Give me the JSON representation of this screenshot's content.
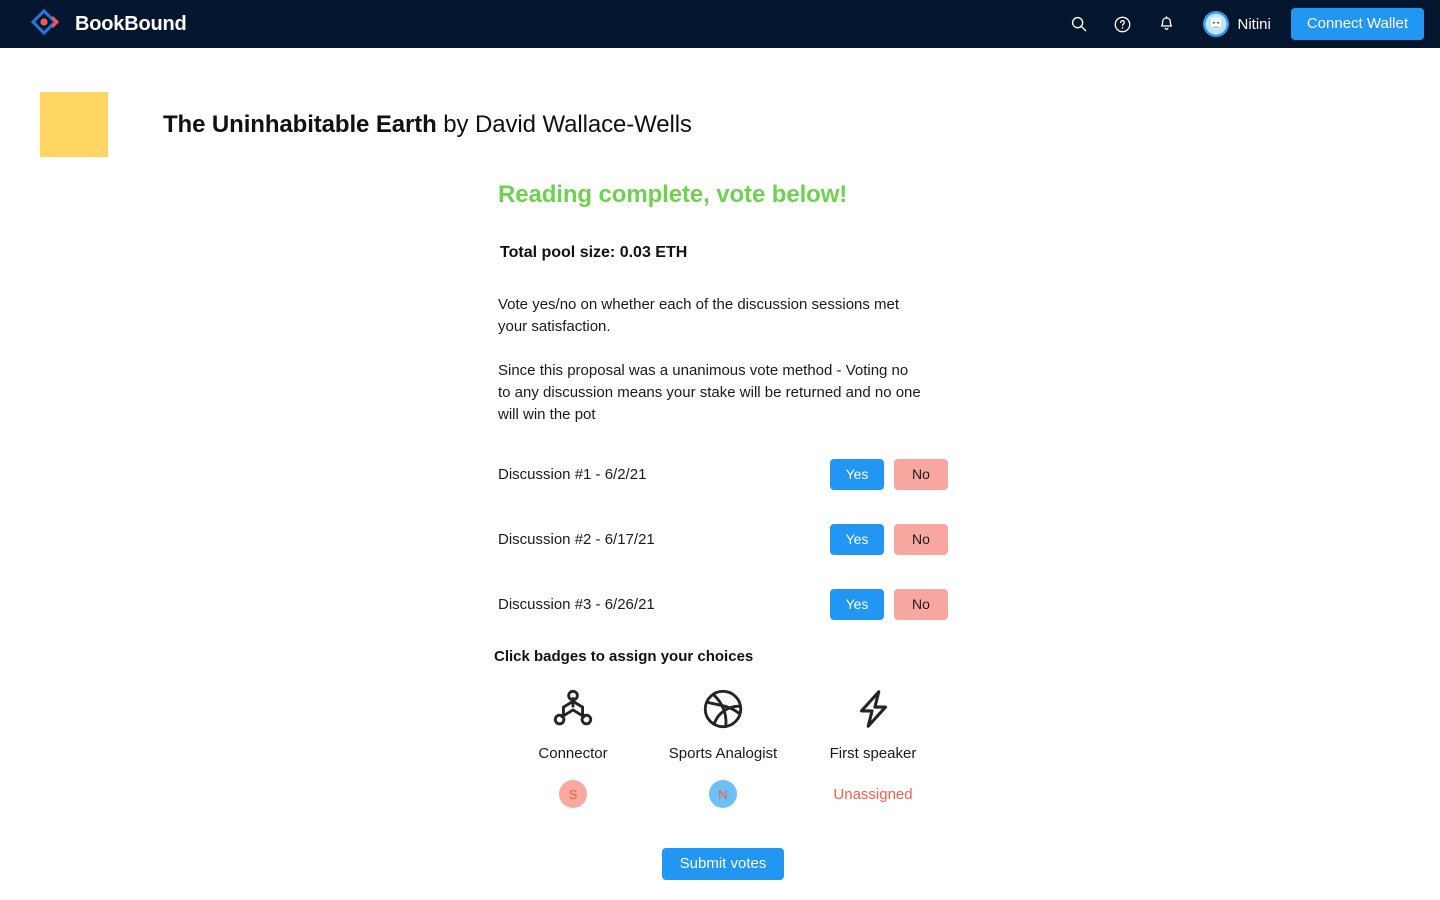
{
  "nav": {
    "brand": "BookBound",
    "icons": [
      {
        "name": "search-icon",
        "label": "Search"
      },
      {
        "name": "help-circle-icon",
        "label": "Help"
      },
      {
        "name": "bell-icon",
        "label": "Notifications"
      }
    ],
    "user_name": "Nitini",
    "connect_wallet_label": "Connect Wallet",
    "background_color": "#04162e",
    "accent_color": "#2196f3"
  },
  "book": {
    "title": "The Uninhabitable Earth",
    "by_author": " by David Wallace-Wells",
    "cover_color": "#ffd564"
  },
  "vote": {
    "heading": "Reading complete, vote below!",
    "heading_color": "#6ed150",
    "pool_size": "Total pool size: 0.03 ETH",
    "paragraph_1": "Vote yes/no on whether each of the discussion sessions met your satisfaction.",
    "paragraph_2": "Since this proposal was a unanimous vote method - Voting no to any discussion means your stake will be returned and no one will win the pot",
    "yes_label": "Yes",
    "no_label": "No",
    "yes_color": "#2196f3",
    "no_color": "#f7a79f",
    "discussions": [
      {
        "label": "Discussion #1 - 6/2/21"
      },
      {
        "label": "Discussion #2 - 6/17/21"
      },
      {
        "label": "Discussion #3 - 6/26/21"
      }
    ],
    "submit_label": "Submit votes"
  },
  "badges": {
    "title": "Click badges to assign your choices",
    "items": [
      {
        "icon": "molecule-connector-icon",
        "label": "Connector",
        "assignee": "S",
        "assignee_type": "initial",
        "dot_color": "#f9a99f"
      },
      {
        "icon": "basketball-icon",
        "label": "Sports Analogist",
        "assignee": "N",
        "assignee_type": "initial",
        "dot_color": "#6dc0f5"
      },
      {
        "icon": "lightning-bolt-icon",
        "label": "First speaker",
        "assignee": "Unassigned",
        "assignee_type": "unassigned",
        "dot_color": "#f4604a"
      }
    ]
  }
}
